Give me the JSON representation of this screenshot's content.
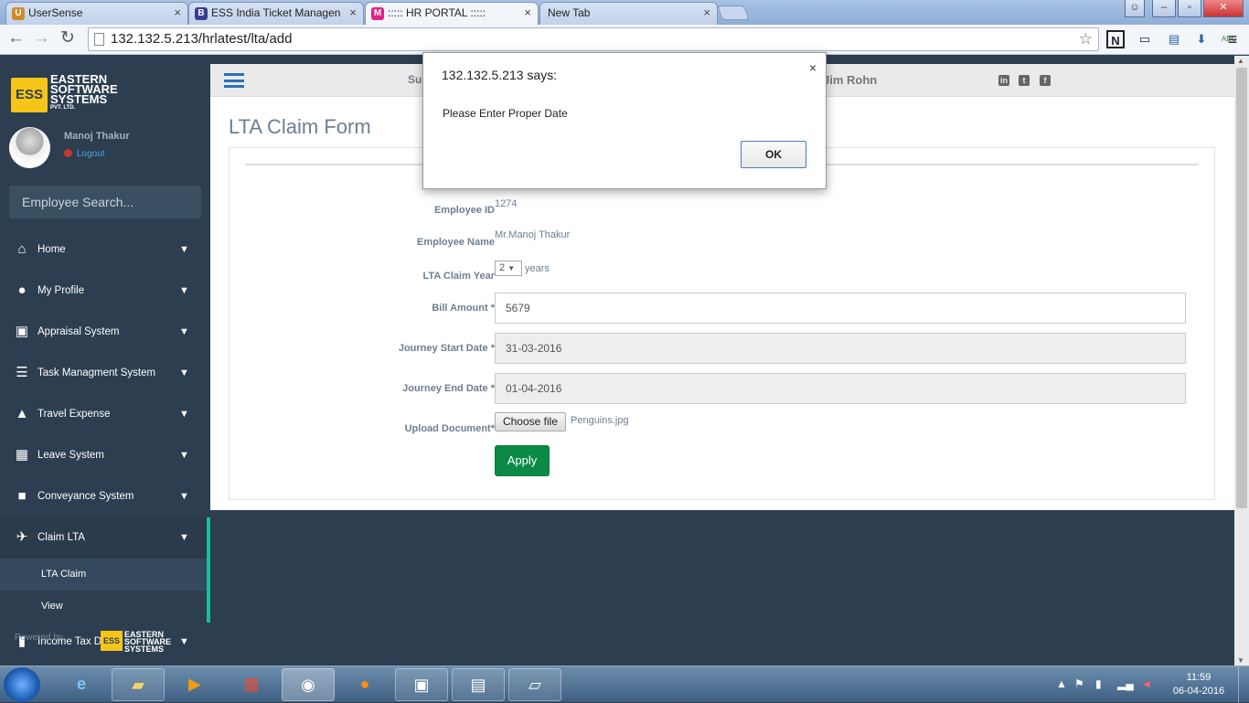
{
  "browser": {
    "tabs": [
      {
        "title": "UserSense",
        "fav": "U",
        "color": "#d08a2c"
      },
      {
        "title": "ESS India Ticket Managen",
        "fav": "B",
        "color": "#3b3f8f"
      },
      {
        "title": "::::: HR PORTAL :::::",
        "fav": "M",
        "color": "#e0218a"
      },
      {
        "title": "New Tab",
        "fav": "",
        "color": "#cccccc"
      }
    ],
    "url": "132.132.5.213/hrlatest/lta/add"
  },
  "sidebar": {
    "logo": {
      "mark": "ESS",
      "line1": "EASTERN",
      "line2": "SOFTWARE",
      "line3": "SYSTEMS",
      "line4": "PVT. LTD."
    },
    "user_name": "Manoj Thakur",
    "logout": "Logout",
    "search_placeholder": "Employee Search...",
    "menu": [
      {
        "label": "Home",
        "icon": "home-icon",
        "glyph": "⌂"
      },
      {
        "label": "My Profile",
        "icon": "user-icon",
        "glyph": "●"
      },
      {
        "label": "Appraisal System",
        "icon": "appraisal-icon",
        "glyph": "▣"
      },
      {
        "label": "Task Managment System",
        "icon": "list-icon",
        "glyph": "☰"
      },
      {
        "label": "Travel Expense",
        "icon": "road-icon",
        "glyph": "▲"
      },
      {
        "label": "Leave System",
        "icon": "calendar-icon",
        "glyph": "▦"
      },
      {
        "label": "Conveyance System",
        "icon": "truck-icon",
        "glyph": "■"
      },
      {
        "label": "Claim LTA",
        "icon": "plane-icon",
        "glyph": "✈"
      }
    ],
    "submenu": [
      "LTA Claim",
      "View"
    ],
    "last_item": "Income Tax De"
  },
  "header": {
    "marquee": "Su",
    "quote_author": "Jim Rohn"
  },
  "form": {
    "title": "LTA Claim Form",
    "employee_id_label": "Employee ID",
    "employee_id": "1274",
    "employee_name_label": "Employee Name",
    "employee_name": "Mr.Manoj Thakur",
    "claim_year_label": "LTA Claim Year",
    "claim_year": "2",
    "years_suffix": "years",
    "bill_label": "Bill Amount *",
    "bill_amount": "5679",
    "start_label": "Journey Start Date *",
    "start_date": "31-03-2016",
    "end_label": "Journey End Date *",
    "end_date": "01-04-2016",
    "upload_label": "Upload Document*",
    "choose_file": "Choose file",
    "file_name": "Penguins.jpg",
    "apply": "Apply"
  },
  "dialog": {
    "title": "132.132.5.213 says:",
    "message": "Please Enter Proper Date",
    "ok": "OK",
    "close": "×"
  },
  "taskbar": {
    "time": "11:59",
    "date": "06-04-2016"
  },
  "watermark": {
    "text": "Powered by",
    "logo_mark": "ESS",
    "l1": "EASTERN",
    "l2": "SOFTWARE",
    "l3": "SYSTEMS"
  }
}
